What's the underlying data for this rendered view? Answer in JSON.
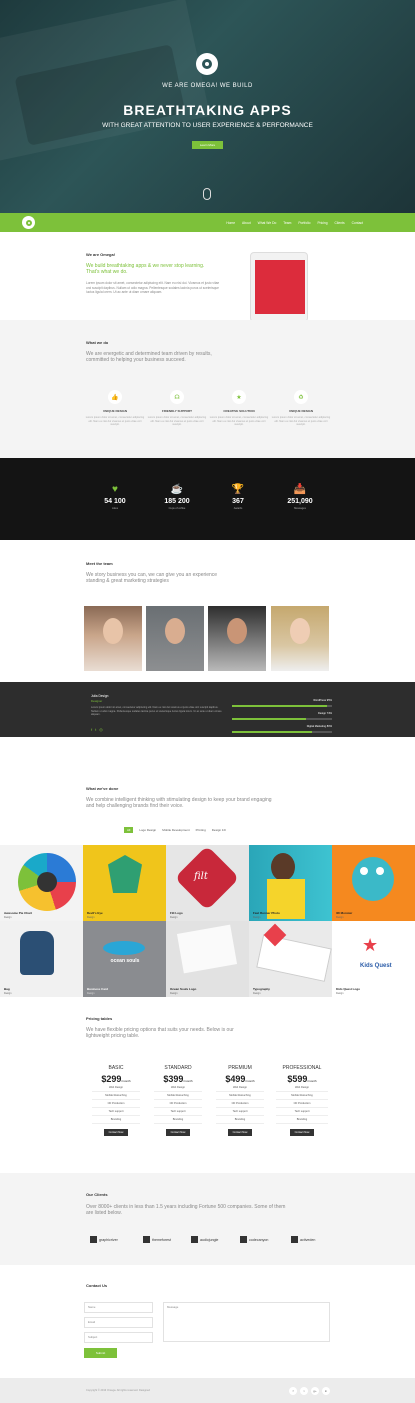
{
  "hero": {
    "tagline": "WE ARE OMEGA! WE BUILD",
    "headline": "BREATHTAKING APPS",
    "subline": "WITH GREAT ATTENTION TO USER EXPERIENCE & PERFORMANCE",
    "button": "Learn More"
  },
  "nav": {
    "items": [
      "Home",
      "About",
      "What We Do",
      "Team",
      "Portfolio",
      "Pricing",
      "Clients",
      "Contact"
    ]
  },
  "about": {
    "kicker": "We are Omega!",
    "lead": "We build breathtaking apps & we never stop learning. That's what we do.",
    "body": "Lorem ipsum dolor sit amet, consectetur adipiscing elit. Nam eu nisi dui. Vivamus et justo vitae orci suscipit dapibus. Nullam ut odio magna. Pellentesque sodales lacinia purus ut scelerisque luctus ligula lorem. Ut ac ante ut diam ornare aliquam."
  },
  "whatwedo": {
    "title": "What we do",
    "lead": "We are energetic and determined team driven by results, committed to helping your business succeed.",
    "services": [
      {
        "icon": "thumbs-up-icon",
        "title": "UNIQUE DESIGN",
        "desc": "Lorem ipsum dolor sit amet, consectetur adipiscing elit. Nam eu nisi dui vivamus et justo vitae orci suscipit."
      },
      {
        "icon": "headset-icon",
        "title": "FRIENDLY SUPPORT",
        "desc": "Lorem ipsum dolor sit amet, consectetur adipiscing elit. Nam eu nisi dui vivamus et justo vitae orci suscipit."
      },
      {
        "icon": "star-icon",
        "title": "CREATIVE SOLUTION",
        "desc": "Lorem ipsum dolor sit amet, consectetur adipiscing elit. Nam eu nisi dui vivamus et justo vitae orci suscipit."
      },
      {
        "icon": "recycle-icon",
        "title": "UNIQUE DESIGN",
        "desc": "Lorem ipsum dolor sit amet, consectetur adipiscing elit. Nam eu nisi dui vivamus et justo vitae orci suscipit."
      }
    ]
  },
  "stats": [
    {
      "icon": "heart-icon",
      "value": "54 100",
      "label": "Likes"
    },
    {
      "icon": "coffee-icon",
      "value": "185 200",
      "label": "Cups of coffee"
    },
    {
      "icon": "trophy-icon",
      "value": "367",
      "label": "Awards"
    },
    {
      "icon": "inbox-icon",
      "value": "251,090",
      "label": "Messages"
    }
  ],
  "team": {
    "title": "Meet the team",
    "lead": "We story business you can, we can give you an experience standing & great marketing strategies",
    "members": [
      {
        "name": "Member 1"
      },
      {
        "name": "Member 2"
      },
      {
        "name": "Member 3"
      },
      {
        "name": "Member 4"
      }
    ],
    "detail": {
      "name": "Julia Design",
      "role": "Designer",
      "bio": "Lorem ipsum dolor sit amet, consectetur adipiscing elit. Nam eu nisi dui vivamus et justo vitae orci suscipit dapibus. Nullam ut odio magna. Pellentesque sodales lacinia purus ut scelerisque luctus ligula lorem. Ut ac ante ut diam ornare aliquam.",
      "skills": [
        {
          "label": "WordPress 95%",
          "pct": 95
        },
        {
          "label": "Design 74%",
          "pct": 74
        },
        {
          "label": "Digital Marketing 80%",
          "pct": 80
        },
        {
          "label": "Support Marketing 100%",
          "pct": 100
        }
      ]
    }
  },
  "portfolio": {
    "title": "What we've done",
    "lead": "We combine intelligent thinking with stimulating design to keep your brand engaging and help challenging brands find their voice.",
    "filters": [
      "All",
      "Logo Design",
      "Mobile Development",
      "Printing",
      "Design 1D"
    ],
    "items": [
      {
        "title": "Awesome Pie Chart",
        "sub": "Design"
      },
      {
        "title": "Devil's Eye",
        "sub": "Design"
      },
      {
        "title": "Filt Logo",
        "sub": "Design"
      },
      {
        "title": "Fast Runner Photo",
        "sub": "Design"
      },
      {
        "title": "3D Monster",
        "sub": "Design"
      },
      {
        "title": "Bag",
        "sub": "Design"
      },
      {
        "title": "Business Card",
        "sub": "Design"
      },
      {
        "title": "Ocean Souls Logo",
        "sub": "Design"
      },
      {
        "title": "Typography",
        "sub": "Design"
      },
      {
        "title": "Kids Quest Logo",
        "sub": "Design"
      }
    ],
    "tile_texts": {
      "filt": "filt",
      "ocean": "ocean souls",
      "kids": "Kids Quest"
    }
  },
  "pricing": {
    "title": "Pricing tables",
    "lead": "We have flexible pricing options that suits your needs. Below is our lightweight pricing table.",
    "plans": [
      {
        "name": "BASIC",
        "price": "$299",
        "period": "/month",
        "features": [
          "Web Design",
          "Mobile Retouching",
          "CD Production",
          "Tech support",
          "Branding"
        ],
        "button": "Contact Now"
      },
      {
        "name": "STANDARD",
        "price": "$399",
        "period": "/month",
        "features": [
          "Web Design",
          "Mobile Retouching",
          "CD Production",
          "Tech support",
          "Branding"
        ],
        "button": "Contact Now"
      },
      {
        "name": "PREMIUM",
        "price": "$499",
        "period": "/month",
        "features": [
          "Web Design",
          "Mobile Retouching",
          "CD Production",
          "Tech support",
          "Branding"
        ],
        "button": "Contact Now"
      },
      {
        "name": "PROFESSIONAL",
        "price": "$599",
        "period": "/month",
        "features": [
          "Web Design",
          "Mobile Retouching",
          "CD Production",
          "Tech support",
          "Branding"
        ],
        "button": "Contact Now"
      }
    ]
  },
  "clients": {
    "title": "Our Clients",
    "lead": "Over 8000+ clients in less than 1.5 years including Fortune 500 companies. Some of them are listed below.",
    "logos": [
      "graphicriver",
      "themeforest",
      "audiojungle",
      "codecanyon",
      "activeden"
    ]
  },
  "contact": {
    "title": "Contact Us",
    "name_ph": "Name",
    "email_ph": "Email",
    "subject_ph": "Subject",
    "message_ph": "Message",
    "button": "Submit"
  },
  "footer": {
    "copyright": "Copyright © 2013 Omega. All rights reserved. Designed",
    "social": [
      "f",
      "t",
      "g+",
      "in"
    ]
  },
  "colors": {
    "accent": "#7dc13a",
    "dark": "#141414"
  }
}
